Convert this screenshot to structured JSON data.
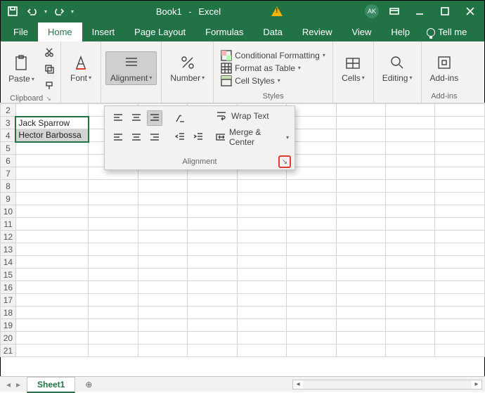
{
  "titlebar": {
    "doc_title": "Book1",
    "app_name": "Excel",
    "user_initials": "AK"
  },
  "menu": {
    "file": "File",
    "home": "Home",
    "insert": "Insert",
    "page_layout": "Page Layout",
    "formulas": "Formulas",
    "data": "Data",
    "review": "Review",
    "view": "View",
    "help": "Help",
    "tell_me": "Tell me"
  },
  "ribbon": {
    "clipboard": {
      "label": "Clipboard",
      "paste": "Paste"
    },
    "font": {
      "label": "Font"
    },
    "alignment": {
      "label": "Alignment"
    },
    "number": {
      "label": "Number"
    },
    "styles": {
      "label": "Styles",
      "conditional": "Conditional Formatting",
      "table": "Format as Table",
      "cellstyles": "Cell Styles"
    },
    "cells": {
      "label": "Cells"
    },
    "editing": {
      "label": "Editing"
    },
    "addins": {
      "label": "Add-ins",
      "btn": "Add-ins"
    }
  },
  "popup": {
    "wrap": "Wrap Text",
    "merge": "Merge & Center",
    "footer": "Alignment"
  },
  "sheet": {
    "rows_visible": [
      2,
      3,
      4,
      5,
      6,
      7,
      8,
      9,
      10,
      11,
      12,
      13,
      14,
      15,
      16,
      17,
      18,
      19,
      20,
      21
    ],
    "cells": {
      "A3": "Jack Sparrow",
      "A4": "Hector Barbossa"
    },
    "selection": [
      "A3",
      "A4"
    ]
  },
  "tabs": {
    "sheet1": "Sheet1"
  }
}
